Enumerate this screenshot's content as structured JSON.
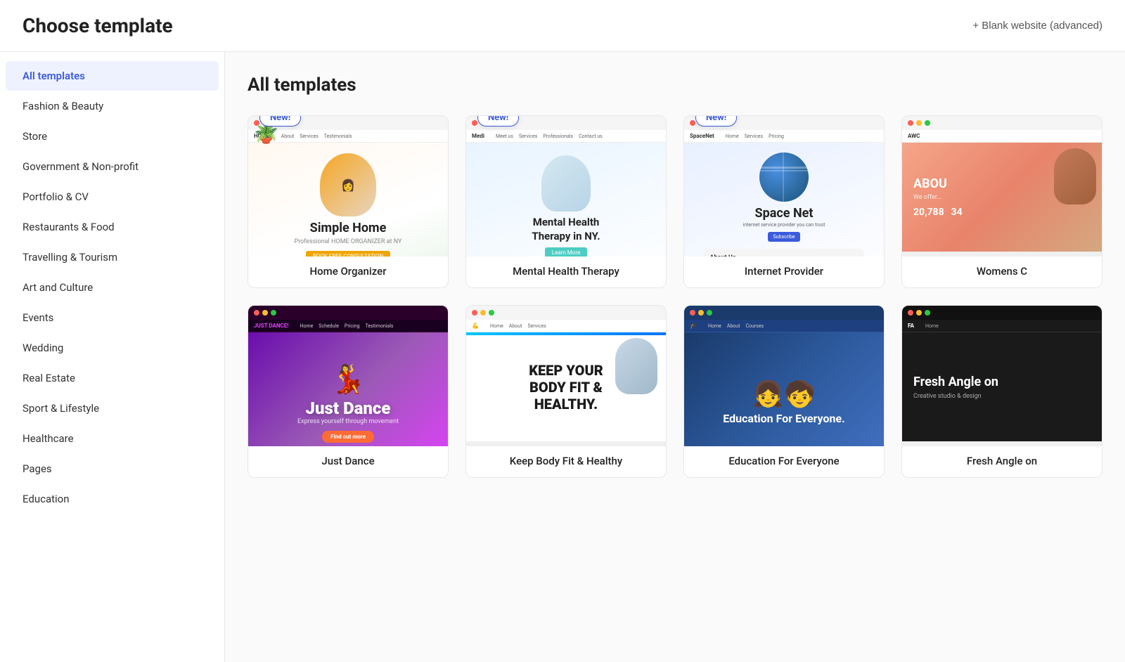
{
  "header": {
    "title": "Choose template",
    "blank_website_btn": "+ Blank website (advanced)"
  },
  "sidebar": {
    "items": [
      {
        "id": "all-templates",
        "label": "All templates",
        "active": true
      },
      {
        "id": "fashion-beauty",
        "label": "Fashion & Beauty",
        "active": false
      },
      {
        "id": "store",
        "label": "Store",
        "active": false
      },
      {
        "id": "government-nonprofit",
        "label": "Government & Non-profit",
        "active": false
      },
      {
        "id": "portfolio-cv",
        "label": "Portfolio & CV",
        "active": false
      },
      {
        "id": "restaurants-food",
        "label": "Restaurants & Food",
        "active": false
      },
      {
        "id": "travelling-tourism",
        "label": "Travelling & Tourism",
        "active": false
      },
      {
        "id": "art-culture",
        "label": "Art and Culture",
        "active": false
      },
      {
        "id": "events",
        "label": "Events",
        "active": false
      },
      {
        "id": "wedding",
        "label": "Wedding",
        "active": false
      },
      {
        "id": "real-estate",
        "label": "Real Estate",
        "active": false
      },
      {
        "id": "sport-lifestyle",
        "label": "Sport & Lifestyle",
        "active": false
      },
      {
        "id": "healthcare",
        "label": "Healthcare",
        "active": false
      },
      {
        "id": "pages",
        "label": "Pages",
        "active": false
      },
      {
        "id": "education",
        "label": "Education",
        "active": false
      }
    ]
  },
  "content": {
    "title": "All templates",
    "templates_row1": [
      {
        "id": "home-organizer",
        "label": "Home Organizer",
        "is_new": true,
        "badge": "New!"
      },
      {
        "id": "mental-health-therapy",
        "label": "Mental Health Therapy",
        "is_new": true,
        "badge": "New!"
      },
      {
        "id": "internet-provider",
        "label": "Internet Provider",
        "is_new": true,
        "badge": "New!"
      },
      {
        "id": "womens-c",
        "label": "Womens C",
        "is_new": false,
        "badge": ""
      }
    ],
    "templates_row2": [
      {
        "id": "just-dance",
        "label": "Just Dance",
        "is_new": false,
        "badge": ""
      },
      {
        "id": "keep-fit",
        "label": "Keep Body Fit & Healthy",
        "is_new": false,
        "badge": ""
      },
      {
        "id": "education-for-everyone",
        "label": "Education For Everyone",
        "is_new": false,
        "badge": ""
      },
      {
        "id": "fresh-angle",
        "label": "Fresh Angle on",
        "is_new": false,
        "badge": ""
      }
    ]
  },
  "colors": {
    "active_sidebar_bg": "#eef2ff",
    "active_sidebar_text": "#3b5bdb",
    "badge_border": "#3b5bdb",
    "badge_text": "#3b5bdb"
  }
}
